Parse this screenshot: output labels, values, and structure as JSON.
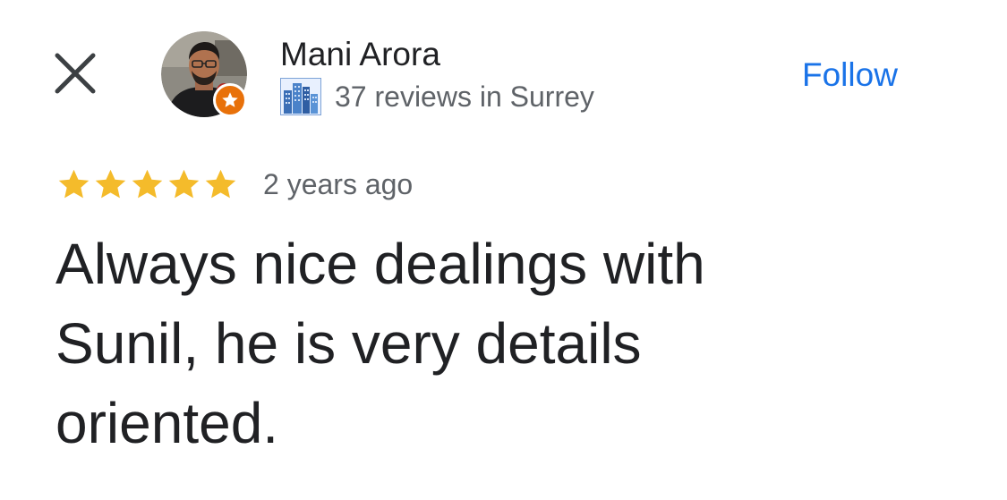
{
  "header": {
    "close_icon": "close-icon",
    "user": {
      "name": "Mani Arora",
      "avatar_icon": "profile-photo",
      "badge_icon": "local-guide-star-icon",
      "badge_color": "#e8710a",
      "city_icon": "city-buildings-icon",
      "reviews_text": "37 reviews in Surrey"
    },
    "follow_label": "Follow",
    "accent_color": "#1a73e8"
  },
  "review": {
    "rating": 5,
    "rating_max": 5,
    "star_color": "#f4bb2b",
    "time_ago": "2 years ago",
    "text": "Always nice dealings with Sunil, he is very details oriented."
  }
}
